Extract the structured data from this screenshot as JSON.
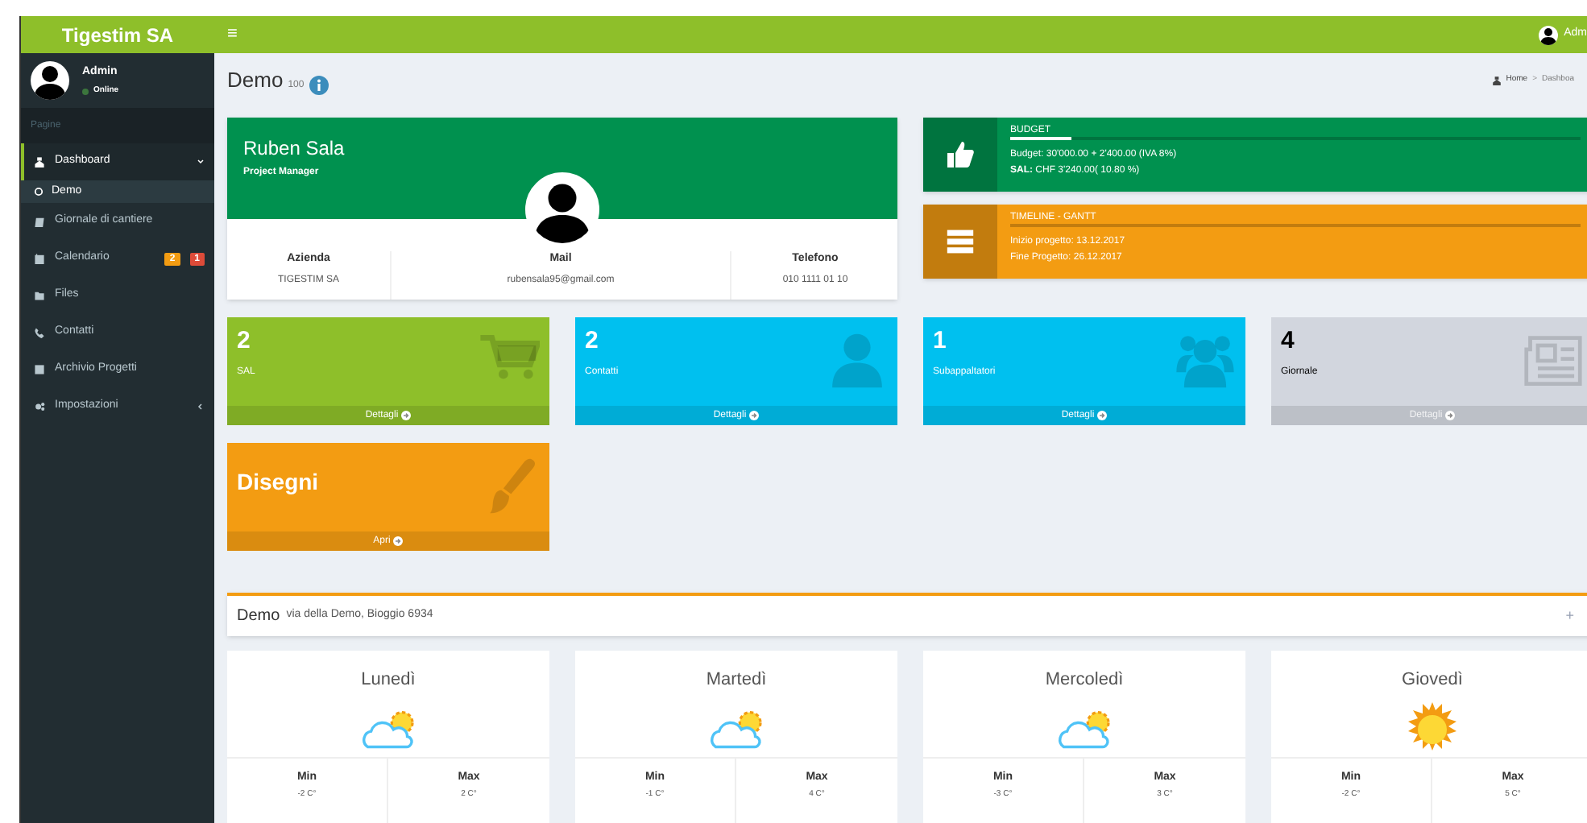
{
  "header": {
    "brand": "Tigestim SA",
    "menu_glyph": "≡",
    "user_name": "Adm"
  },
  "sidebar": {
    "user": {
      "name": "Admin",
      "status": "Online"
    },
    "section": "Pagine",
    "items": [
      {
        "label": "Dashboard",
        "selected": true,
        "expanded": true,
        "children": [
          {
            "label": "Demo",
            "selected": true
          }
        ]
      },
      {
        "label": "Giornale di cantiere",
        "selected": false
      },
      {
        "label": "Calendario",
        "selected": false,
        "badges": [
          {
            "text": "2",
            "color": "#f39c12"
          },
          {
            "text": "1",
            "color": "#dd4b39"
          }
        ]
      },
      {
        "label": "Files",
        "selected": false
      },
      {
        "label": "Contatti",
        "selected": false
      },
      {
        "label": "Archivio Progetti",
        "selected": false
      },
      {
        "label": "Impostazioni",
        "selected": false,
        "expanded": false
      }
    ]
  },
  "page": {
    "title": "Demo",
    "subtitle": "100",
    "breadcrumb": [
      "Home",
      "Dashboa"
    ],
    "breadcrumb_separator": ">"
  },
  "profile": {
    "name": "Ruben Sala",
    "role": "Project Manager",
    "fields": [
      {
        "label": "Azienda",
        "value": "TIGESTIM SA"
      },
      {
        "label": "Mail",
        "value": "rubensala95@gmail.com"
      },
      {
        "label": "Telefono",
        "value": "010 1111 01 10"
      }
    ]
  },
  "info_boxes": [
    {
      "kind": "budget",
      "title": "BUDGET",
      "color": "#00914f",
      "level": 0.108,
      "lines": [
        "Budget: 30'000.00 + 2'400.00 (IVA 8%)",
        "**SAL:** CHF 3'240.00( 10.80 %)"
      ]
    },
    {
      "kind": "timeline",
      "title": "TIMELINE - GANTT",
      "color": "#f39c12",
      "lines": [
        "Inizio progetto: 13.12.2017",
        "Fine Progetto: 26.12.2017"
      ]
    }
  ],
  "tiles": [
    {
      "kind": "count",
      "value": "2",
      "label": "SAL",
      "footer": "Dettagli",
      "color": "#8ebf2a"
    },
    {
      "kind": "count",
      "value": "2",
      "label": "Contatti",
      "footer": "Dettagli",
      "color": "#00c0ef"
    },
    {
      "kind": "count",
      "value": "1",
      "label": "Subappaltatori",
      "footer": "Dettagli",
      "color": "#00c0ef"
    },
    {
      "kind": "count",
      "value": "4",
      "label": "Giornale",
      "footer": "Dettagli",
      "color": "#d2d6de"
    },
    {
      "kind": "title",
      "value": "Disegni",
      "footer": "Apri",
      "color": "#f39c12"
    }
  ],
  "location": {
    "title": "Demo",
    "subtitle": "via della Demo, Bioggio 6934",
    "add_glyph": "+"
  },
  "weather": [
    {
      "day": "Lunedì",
      "kind": "partly_cloudy",
      "min_label": "Min",
      "min": "-2 C°",
      "max_label": "Max",
      "max": "2 C°"
    },
    {
      "day": "Martedì",
      "kind": "partly_cloudy",
      "min_label": "Min",
      "min": "-1 C°",
      "max_label": "Max",
      "max": "4 C°"
    },
    {
      "day": "Mercoledì",
      "kind": "partly_cloudy",
      "min_label": "Min",
      "min": "-3 C°",
      "max_label": "Max",
      "max": "3 C°"
    },
    {
      "day": "Giovedì",
      "kind": "sunny",
      "min_label": "Min",
      "min": "-2 C°",
      "max_label": "Max",
      "max": "5 C°"
    }
  ]
}
